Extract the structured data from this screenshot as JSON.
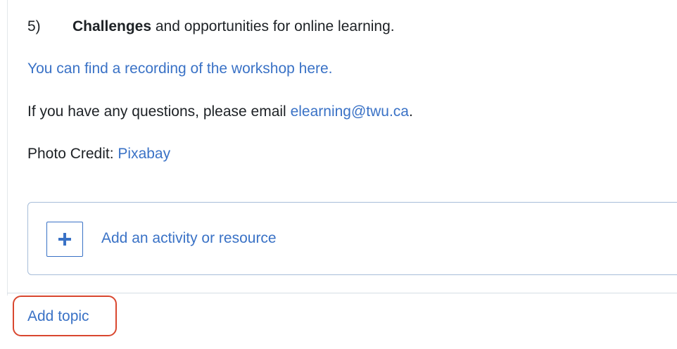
{
  "content": {
    "list_item": {
      "number": "5)",
      "bold_word": "Challenges",
      "rest_text": " and opportunities for online learning."
    },
    "recording_link": "You can find a recording of the workshop here.",
    "email_line": {
      "prefix": "If you have any questions, please email ",
      "email": "elearning@twu.ca",
      "suffix": "."
    },
    "photo_credit": {
      "prefix": "Photo Credit: ",
      "link": "Pixabay"
    }
  },
  "activity": {
    "label": "Add an activity or resource",
    "icon": "plus-icon"
  },
  "add_topic": {
    "label": "Add topic"
  },
  "colors": {
    "link": "#3a72c6",
    "highlight": "#d9472f",
    "border": "#a7bdd9"
  }
}
